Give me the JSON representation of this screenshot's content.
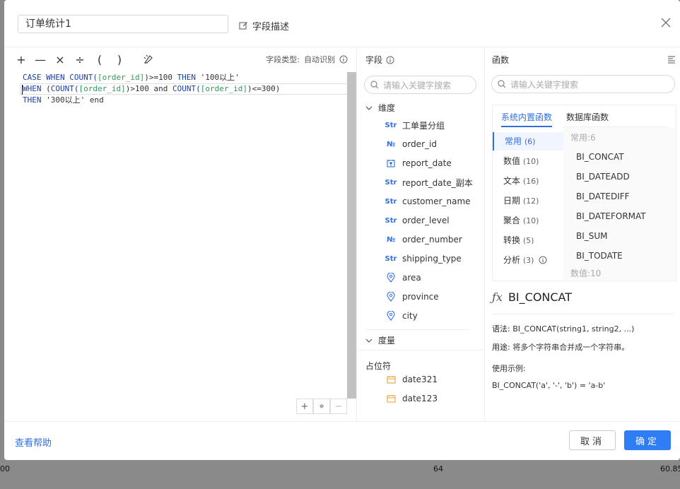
{
  "background": {
    "bottom_left": "00",
    "bottom_mid": "64",
    "bottom_right": "60.85"
  },
  "dialog": {
    "name_value": "订单统计1",
    "field_desc_label": "字段描述"
  },
  "toolbar": {
    "buttons": [
      "+",
      "—",
      "×",
      "÷",
      "(",
      ")"
    ],
    "field_type_label": "字段类型:",
    "field_type_value": "自动识别"
  },
  "editor": {
    "line1": {
      "kw1": "CASE WHEN COUNT(",
      "f1": "[order_id]",
      "rest1": ")>=100 ",
      "kw2": "THEN",
      "rest2": " '100以上'"
    },
    "line2": {
      "kw1": "WHEN",
      "rest0": " (",
      "kw2": "COUNT(",
      "f1": "[order_id]",
      "rest1": ")>100 and ",
      "kw3": "COUNT(",
      "f2": "[order_id]",
      "rest2": ")<=300)"
    },
    "line3": {
      "kw1": "THEN",
      "rest1": " '300以上' end"
    }
  },
  "fields": {
    "title": "字段",
    "search_placeholder": "请输入关键字搜索",
    "dimension_label": "维度",
    "dimensions": [
      {
        "icon": "Str",
        "name": "工单量分组"
      },
      {
        "icon": "№",
        "name": "order_id"
      },
      {
        "icon": "date",
        "name": "report_date"
      },
      {
        "icon": "Str",
        "name": "report_date_副本"
      },
      {
        "icon": "Str",
        "name": "customer_name"
      },
      {
        "icon": "Str",
        "name": "order_level"
      },
      {
        "icon": "№",
        "name": "order_number"
      },
      {
        "icon": "Str",
        "name": "shipping_type"
      },
      {
        "icon": "geo",
        "name": "area"
      },
      {
        "icon": "geo",
        "name": "province"
      },
      {
        "icon": "geo",
        "name": "city"
      }
    ],
    "measure_label": "度量",
    "placeholder_label": "占位符",
    "placeholders": [
      "date321",
      "date123"
    ]
  },
  "functions": {
    "title": "函数",
    "search_placeholder": "请输入关键字搜索",
    "tab_builtin": "系统内置函数",
    "tab_db": "数据库函数",
    "categories": [
      {
        "name": "常用",
        "count": "(6)"
      },
      {
        "name": "数值",
        "count": "(10)"
      },
      {
        "name": "文本",
        "count": "(16)"
      },
      {
        "name": "日期",
        "count": "(12)"
      },
      {
        "name": "聚合",
        "count": "(10)"
      },
      {
        "name": "转换",
        "count": "(5)"
      },
      {
        "name": "分析",
        "count": "(3)"
      }
    ],
    "group_common": "常用:6",
    "items": [
      "BI_CONCAT",
      "BI_DATEADD",
      "BI_DATEDIFF",
      "BI_DATEFORMAT",
      "BI_SUM",
      "BI_TODATE"
    ],
    "group_numeric": "数值:10",
    "selected_name": "BI_CONCAT",
    "syntax_label": "语法:",
    "syntax_value": "BI_CONCAT(string1, string2, ...)",
    "usage_label": "用途:",
    "usage_value": "将多个字符串合并成一个字符串。",
    "example_label": "使用示例:",
    "example_value": "BI_CONCAT('a', '-', 'b') = 'a-b'"
  },
  "footer": {
    "help_label": "查看帮助",
    "cancel_label": "取消",
    "ok_label": "确定"
  },
  "colors": {
    "accent": "#2f7df4",
    "keyword": "#1a3fa8",
    "field": "#2a9d57"
  }
}
